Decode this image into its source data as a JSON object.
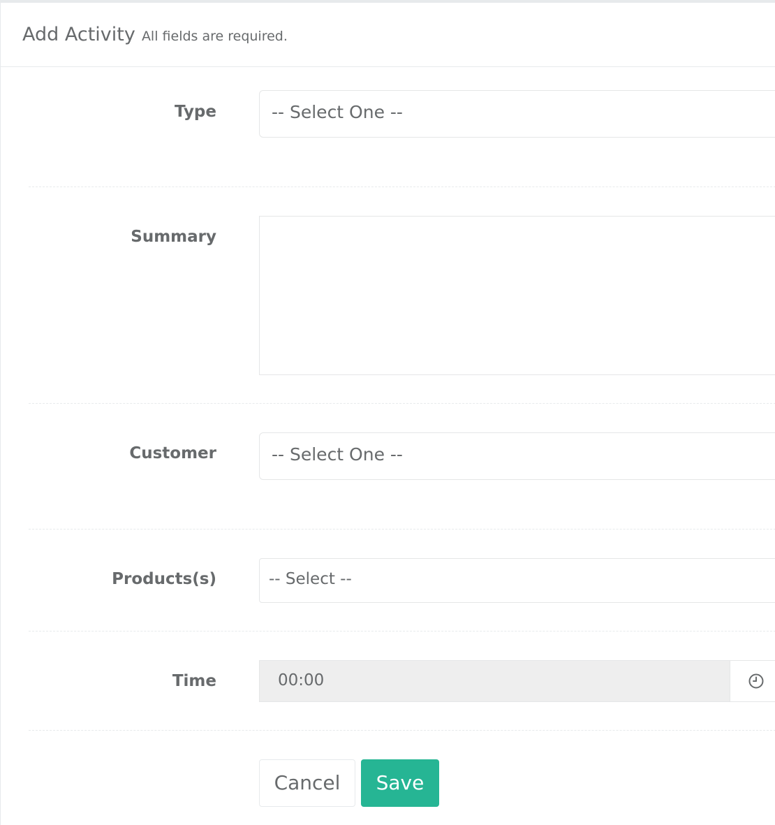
{
  "header": {
    "title": "Add Activity",
    "subtitle": "All fields are required."
  },
  "form": {
    "type": {
      "label": "Type",
      "value": "-- Select One --"
    },
    "summary": {
      "label": "Summary",
      "value": ""
    },
    "customer": {
      "label": "Customer",
      "value": "-- Select One --"
    },
    "products": {
      "label": "Products(s)",
      "placeholder": "-- Select --"
    },
    "time": {
      "label": "Time",
      "value": "00:00"
    }
  },
  "actions": {
    "cancel_label": "Cancel",
    "save_label": "Save"
  },
  "icons": {
    "time_addon": "clock-icon"
  },
  "colors": {
    "accent": "#26b594",
    "text": "#676a6c",
    "border": "#e5e6e7",
    "readonly_bg": "#eeeeee"
  }
}
